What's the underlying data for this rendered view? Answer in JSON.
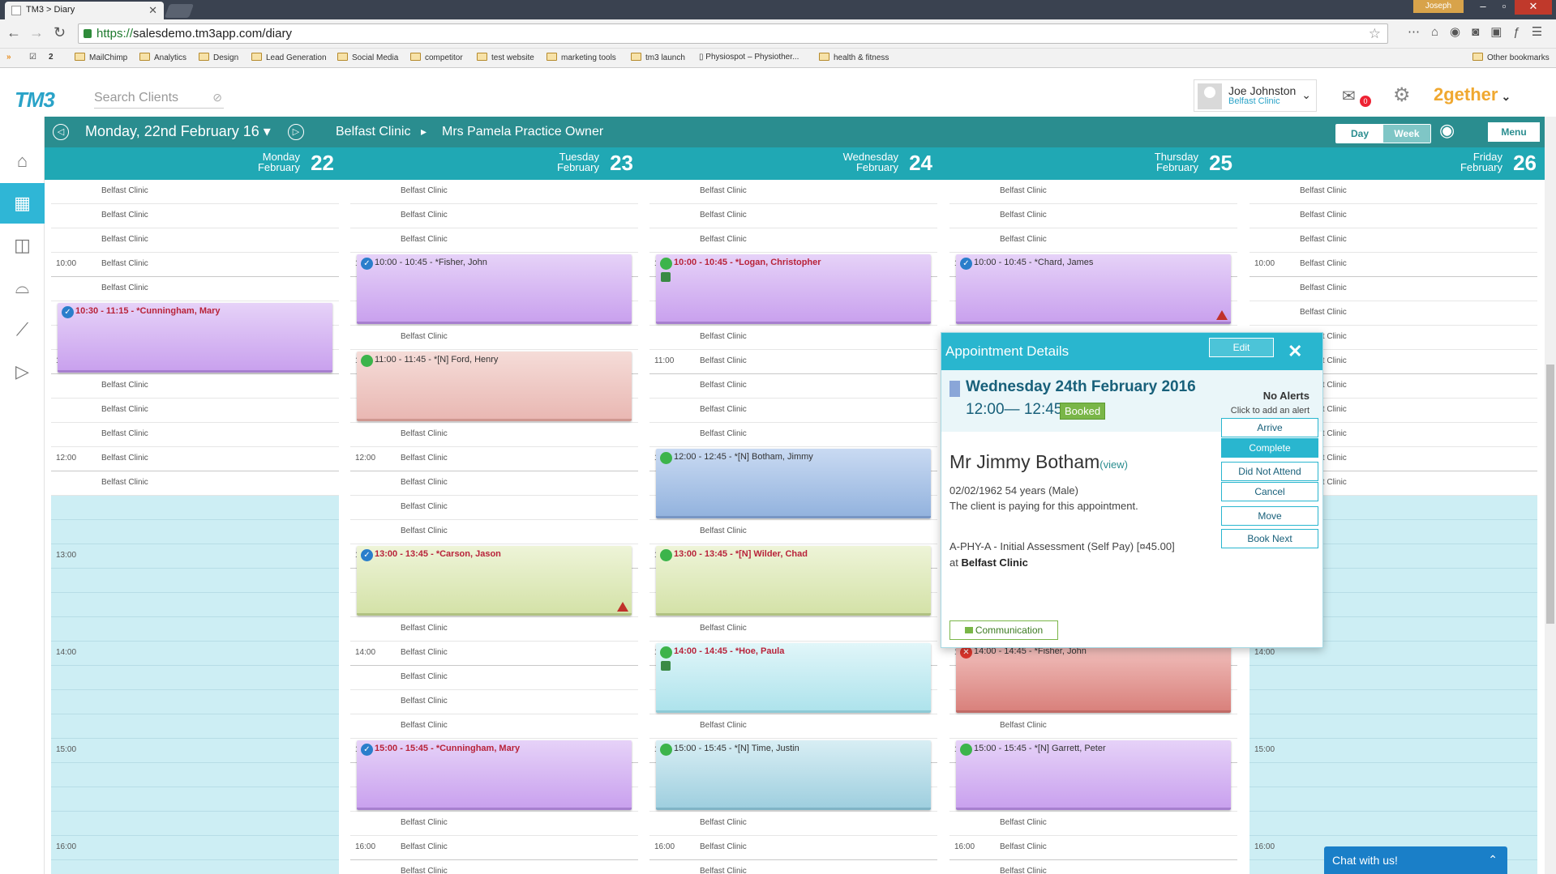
{
  "browser": {
    "tab_title": "TM3 > Diary",
    "url_scheme": "https://",
    "url_rest": "salesdemo.tm3app.com/diary",
    "user_badge": "Joseph",
    "bookmarks": [
      {
        "label": "MailChimp"
      },
      {
        "label": "Analytics"
      },
      {
        "label": "Design"
      },
      {
        "label": "Lead Generation"
      },
      {
        "label": "Social Media"
      },
      {
        "label": "competitor"
      },
      {
        "label": "test website"
      },
      {
        "label": "marketing tools"
      },
      {
        "label": "tm3 launch"
      },
      {
        "label": "Physiospot – Physiother..."
      },
      {
        "label": "health & fitness"
      }
    ],
    "other_bookmarks": "Other bookmarks"
  },
  "header": {
    "logo": "TM3",
    "search_placeholder": "Search Clients",
    "user_name": "Joe Johnston",
    "user_clinic": "Belfast Clinic",
    "inbox_count": "0",
    "brand": "2gether"
  },
  "toolbar": {
    "date": "Monday, 22nd February 16",
    "clinic": "Belfast Clinic",
    "separator": "▸",
    "practitioner": "Mrs Pamela Practice Owner",
    "day_label": "Day",
    "week_label": "Week",
    "menu_label": "Menu"
  },
  "days": [
    {
      "name": "Monday",
      "month": "February",
      "num": "22"
    },
    {
      "name": "Tuesday",
      "month": "February",
      "num": "23"
    },
    {
      "name": "Wednesday",
      "month": "February",
      "num": "24"
    },
    {
      "name": "Thursday",
      "month": "February",
      "num": "25"
    },
    {
      "name": "Friday",
      "month": "February",
      "num": "26"
    }
  ],
  "slot_label": "Belfast Clinic",
  "time_labels": [
    "10:00",
    "11:00",
    "12:00",
    "13:00",
    "14:00",
    "15:00",
    "16:00"
  ],
  "appointments": [
    {
      "day": 0,
      "slot": 5,
      "text": "10:30 - 11:15 - *Cunningham, Mary",
      "color": "purple",
      "status": "tick",
      "highlight": true
    },
    {
      "day": 1,
      "slot": 3,
      "text": "10:00 - 10:45 - *Fisher, John",
      "color": "purple",
      "status": "tick",
      "highlight": false
    },
    {
      "day": 1,
      "slot": 7,
      "text": "11:00 - 11:45 - *[N] Ford, Henry",
      "color": "pink",
      "status": "dot",
      "highlight": false
    },
    {
      "day": 1,
      "slot": 15,
      "text": "13:00 - 13:45 - *Carson, Jason",
      "color": "green",
      "status": "tick",
      "highlight": true,
      "warn": true
    },
    {
      "day": 1,
      "slot": 23,
      "text": "15:00 - 15:45 - *Cunningham, Mary",
      "color": "purple",
      "status": "tick",
      "highlight": true
    },
    {
      "day": 2,
      "slot": 3,
      "text": "10:00 - 10:45 - *Logan, Christopher",
      "color": "purple",
      "status": "dot",
      "highlight": true,
      "tag": true
    },
    {
      "day": 2,
      "slot": 11,
      "text": "12:00 - 12:45 - *[N] Botham, Jimmy",
      "color": "blue",
      "status": "dot",
      "highlight": false
    },
    {
      "day": 2,
      "slot": 15,
      "text": "13:00 - 13:45 - *[N] Wilder, Chad",
      "color": "green",
      "status": "dot",
      "highlight": true
    },
    {
      "day": 2,
      "slot": 19,
      "text": "14:00 - 14:45 - *Hoe, Paula",
      "color": "cyan",
      "status": "dot",
      "highlight": true,
      "tag": true
    },
    {
      "day": 2,
      "slot": 23,
      "text": "15:00 - 15:45 - *[N] Time, Justin",
      "color": "teal",
      "status": "dot",
      "highlight": false
    },
    {
      "day": 3,
      "slot": 3,
      "text": "10:00 - 10:45 - *Chard, James",
      "color": "purple",
      "status": "tick",
      "highlight": false,
      "warn": true
    },
    {
      "day": 3,
      "slot": 19,
      "text": "14:00 - 14:45 - *Fisher, John",
      "color": "red",
      "status": "cross",
      "highlight": false
    },
    {
      "day": 3,
      "slot": 23,
      "text": "15:00 - 15:45 - *[N] Garrett, Peter",
      "color": "purple",
      "status": "dot",
      "highlight": false
    }
  ],
  "popup": {
    "title": "Appointment Details",
    "edit_label": "Edit",
    "date": "Wednesday 24th February 2016",
    "time": "12:00— 12:45",
    "status": "Booked",
    "alerts": "No Alerts",
    "alert_link": "Click to add an alert",
    "client_name": "Mr Jimmy Botham",
    "view_link": "(view)",
    "dob": "02/02/1962 54 years (Male)",
    "payment": "The client is paying for this appointment.",
    "service": "A-PHY-A - Initial Assessment (Self Pay) [¤45.00]",
    "at_label": "at",
    "location": "Belfast Clinic",
    "actions": [
      "Arrive",
      "Complete",
      "Did Not Attend",
      "Cancel",
      "Move",
      "Book Next"
    ],
    "communication_label": "Communication"
  },
  "chat": {
    "label": "Chat with us!"
  }
}
